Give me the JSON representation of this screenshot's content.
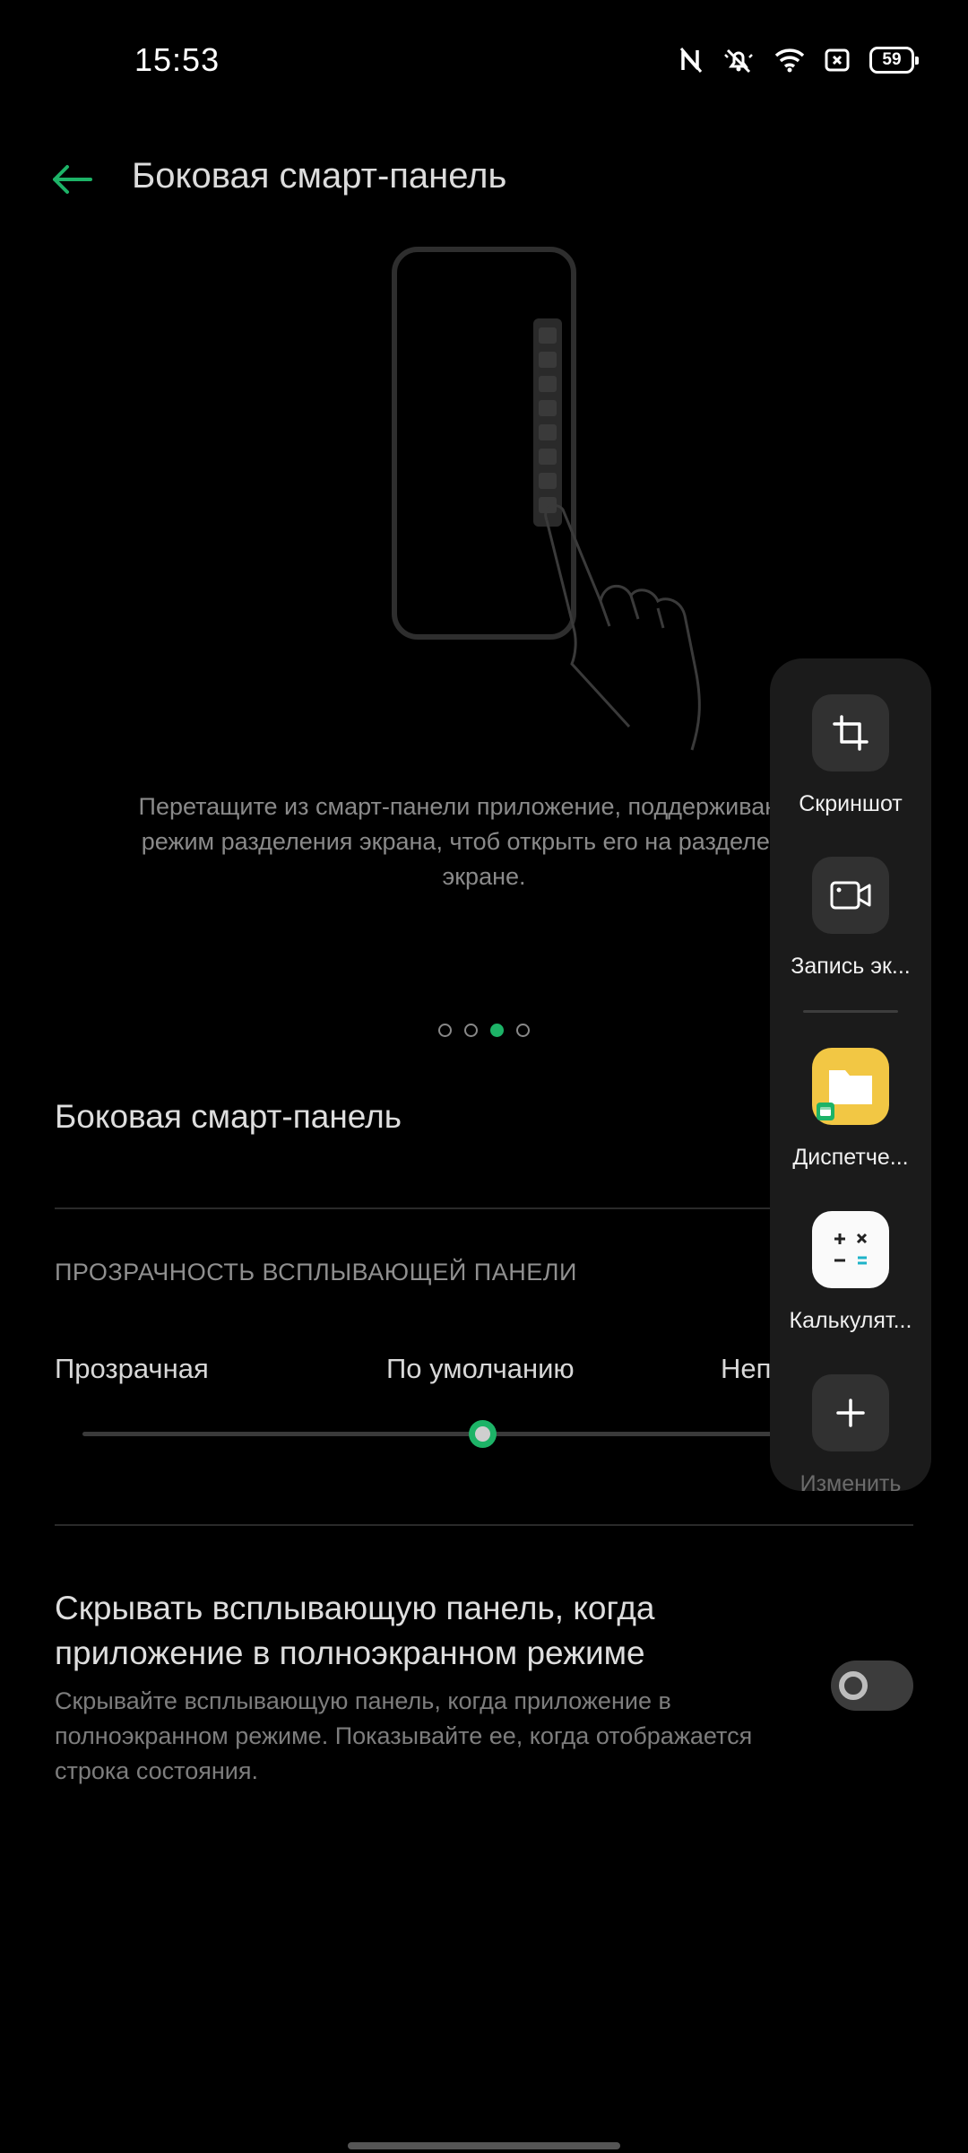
{
  "status_bar": {
    "time": "15:53",
    "battery": "59",
    "icons": [
      "nfc-icon",
      "mute-icon",
      "wifi-icon",
      "sim-icon",
      "battery-icon"
    ]
  },
  "header": {
    "title": "Боковая смарт-панель",
    "back_icon": "back-arrow-icon"
  },
  "illustration": {
    "instruction": "Перетащите из смарт-панели приложение, поддерживающее режим разделения экрана, чтоб открыть его на разделенном экране."
  },
  "pager": {
    "count": 4,
    "active_index": 2
  },
  "settings": {
    "sidebar_toggle_title": "Боковая смарт-панель",
    "transparency_header": "ПРОЗРАЧНОСТЬ ВСПЛЫВАЮЩЕЙ ПАНЕЛИ",
    "slider": {
      "label_left": "Прозрачная",
      "label_middle": "По умолчанию",
      "label_right": "Неп",
      "value_fraction": 0.5
    },
    "hide_panel": {
      "title": "Скрывать всплывающую панель, когда приложение в полноэкранном режиме",
      "description": "Скрывайте всплывающую панель, когда приложение в полноэкранном режиме. Показывайте ее, когда отображается строка состояния.",
      "enabled": false
    }
  },
  "smart_sidebar": {
    "items": [
      {
        "label": "Скриншот",
        "icon": "crop-icon"
      },
      {
        "label": "Запись эк...",
        "icon": "video-record-icon"
      },
      {
        "label": "Диспетче...",
        "icon": "folder-icon"
      },
      {
        "label": "Калькулят...",
        "icon": "calculator-icon"
      },
      {
        "label": "Изменить",
        "icon": "plus-icon"
      }
    ]
  },
  "colors": {
    "accent": "#1db367",
    "background": "#000000",
    "panel": "#1b1b1b"
  }
}
